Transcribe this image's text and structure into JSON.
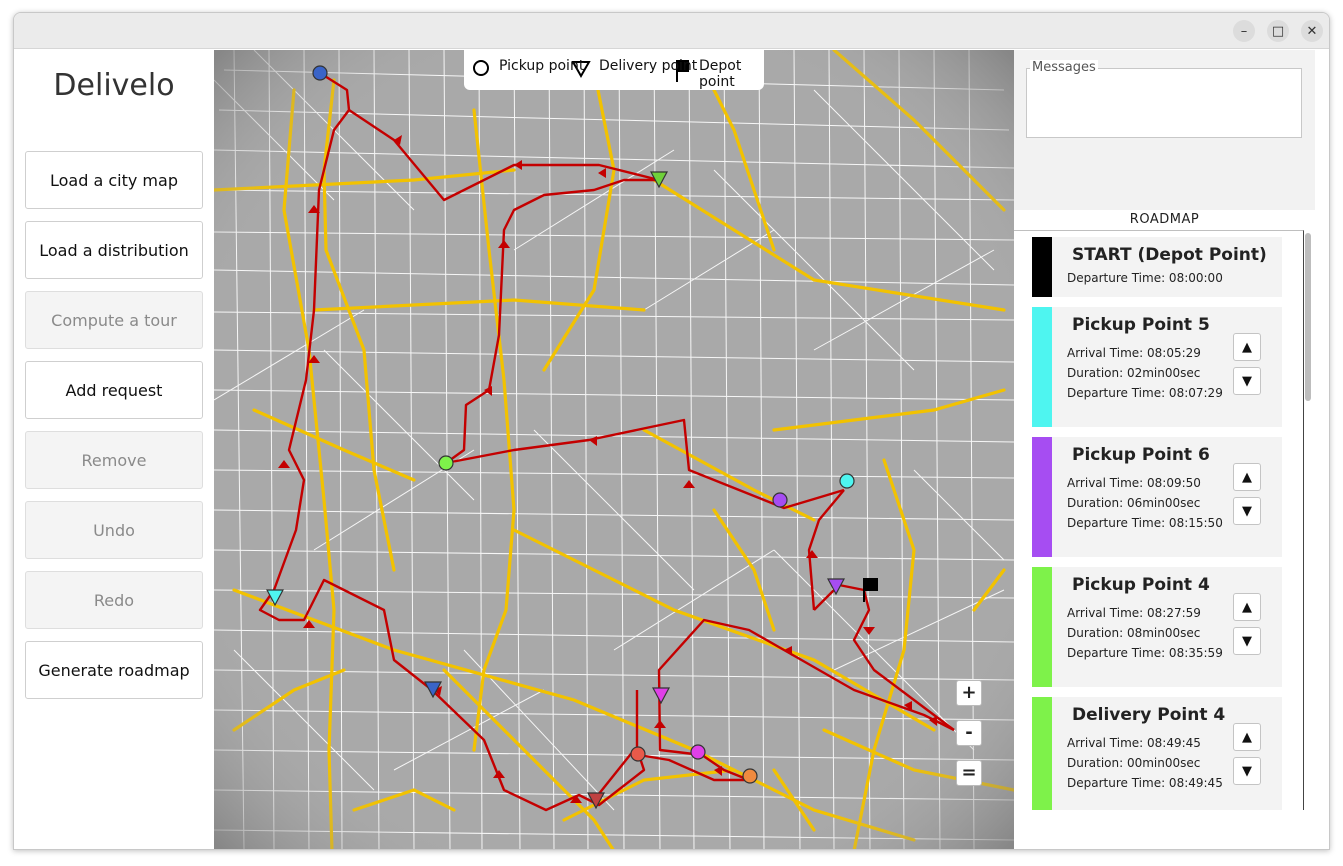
{
  "app": {
    "title": "Delivelo"
  },
  "window_controls": {
    "minimize": "–",
    "maximize": "□",
    "close": "✕"
  },
  "sidebar": {
    "buttons": [
      {
        "label": "Load a city map",
        "enabled": true
      },
      {
        "label": "Load a distribution",
        "enabled": true
      },
      {
        "label": "Compute a tour",
        "enabled": false
      },
      {
        "label": "Add request",
        "enabled": true
      },
      {
        "label": "Remove",
        "enabled": false
      },
      {
        "label": "Undo",
        "enabled": false
      },
      {
        "label": "Redo",
        "enabled": false
      },
      {
        "label": "Generate roadmap",
        "enabled": true
      }
    ]
  },
  "map": {
    "legend": {
      "pickup": "Pickup point",
      "delivery": "Delivery point",
      "depot": "Depot point"
    },
    "zoom": {
      "in": "+",
      "out": "-",
      "reset": "="
    },
    "colors": {
      "background": "#a8a8a8",
      "major_road": "#f2c200",
      "minor_road": "#ffffff",
      "route": "#c40000"
    }
  },
  "messages": {
    "label": "Messages",
    "value": ""
  },
  "roadmap": {
    "title": "ROADMAP",
    "items": [
      {
        "title": "START (Depot Point)",
        "color": "#000000",
        "departure": "Departure Time: 08:00:00"
      },
      {
        "title": "Pickup Point 5",
        "color": "#4ef5f0",
        "arrival": "Arrival Time: 08:05:29",
        "duration": "Duration: 02min00sec",
        "departure": "Departure Time: 08:07:29"
      },
      {
        "title": "Pickup Point 6",
        "color": "#a64df2",
        "arrival": "Arrival Time: 08:09:50",
        "duration": "Duration: 06min00sec",
        "departure": "Departure Time: 08:15:50"
      },
      {
        "title": "Pickup Point 4",
        "color": "#7ef24a",
        "arrival": "Arrival Time: 08:27:59",
        "duration": "Duration: 08min00sec",
        "departure": "Departure Time: 08:35:59"
      },
      {
        "title": "Delivery Point 4",
        "color": "#7ef24a",
        "arrival": "Arrival Time: 08:49:45",
        "duration": "Duration: 00min00sec",
        "departure": "Departure Time: 08:49:45"
      }
    ],
    "up_label": "▲",
    "down_label": "▼"
  }
}
